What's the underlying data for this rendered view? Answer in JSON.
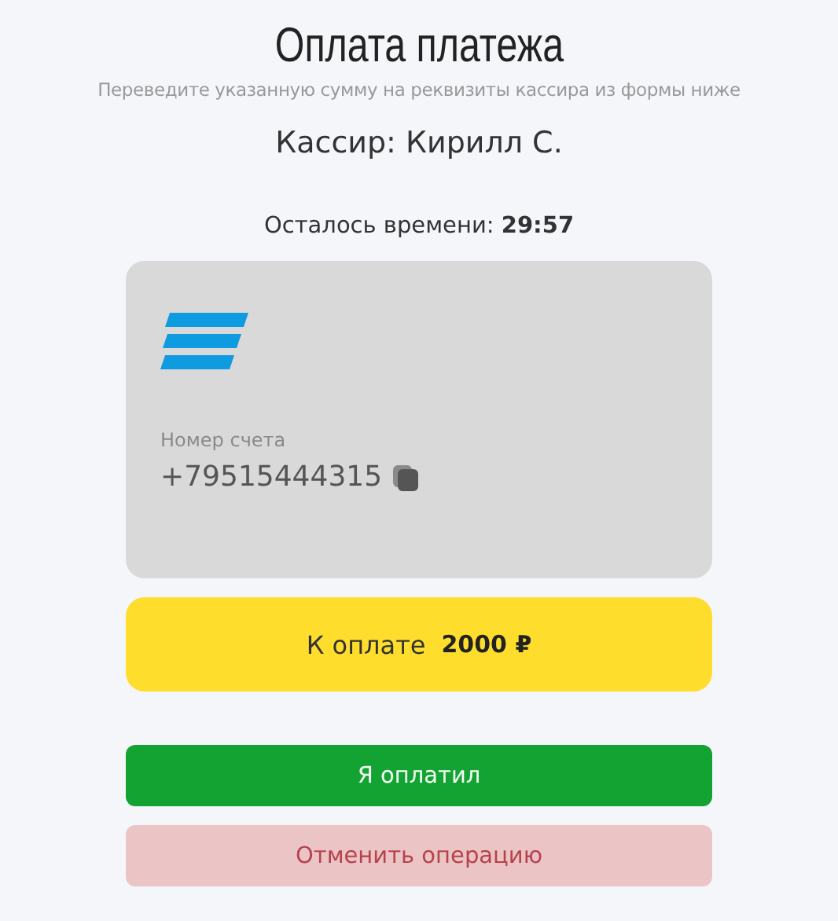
{
  "title": "Оплата платежа",
  "subtitle": "Переведите указанную сумму на реквизиты кассира из формы ниже",
  "cashier": "Кассир: Кирилл С.",
  "timer": "Осталось времени: **29:57**",
  "card": {
    "account_label": "Номер счета",
    "account_number": "+79515444315"
  },
  "amount": {
    "label": "К оплате",
    "value": "2000 ₽"
  },
  "buttons": [
    {
      "kind": "confirm",
      "label": "Я оплатил"
    },
    {
      "kind": "cancel",
      "label": "Отменить операцию"
    }
  ]
}
